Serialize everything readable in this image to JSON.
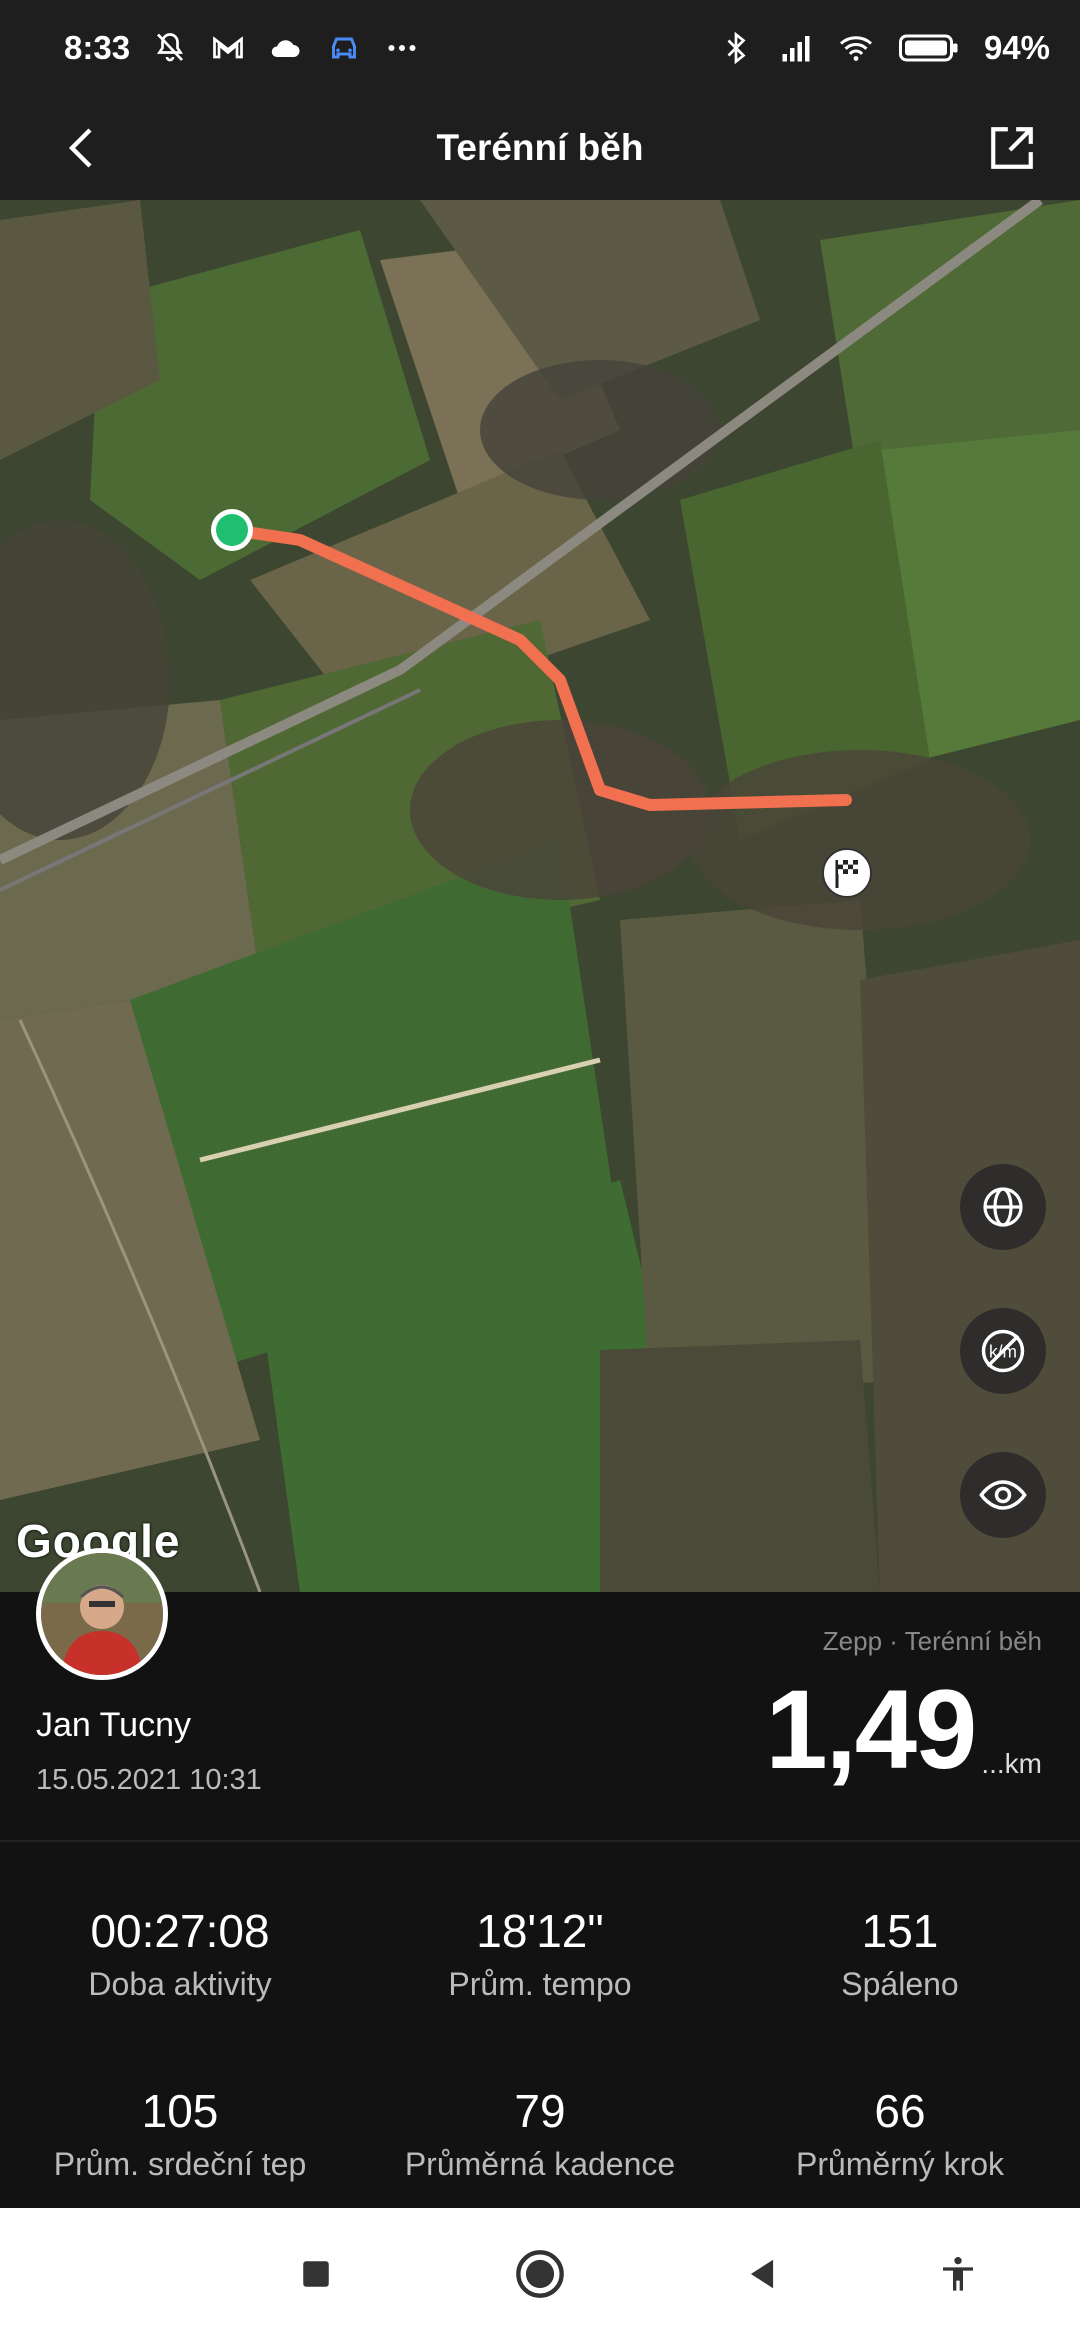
{
  "status_bar": {
    "time": "8:33",
    "battery": "94%",
    "icons_left": [
      "mute-icon",
      "gmail-icon",
      "cloud-icon",
      "car-icon",
      "more-dots-icon"
    ],
    "icons_right": [
      "bluetooth-icon",
      "signal-icon",
      "wifi-icon",
      "battery-icon"
    ]
  },
  "header": {
    "title": "Terénní běh",
    "back_icon": "back-arrow-icon",
    "share_icon": "share-icon"
  },
  "map": {
    "provider_logo": "Google",
    "route_color": "#f07050",
    "start_color": "#1fbf6f",
    "controls": [
      "globe-icon",
      "km-markers-off-icon",
      "eye-icon"
    ]
  },
  "activity": {
    "user_name": "Jan Tucny",
    "date": "15.05.2021 10:31",
    "source": "Zepp · Terénní běh",
    "distance": "1,49",
    "distance_unit": "...km"
  },
  "stats": [
    {
      "value": "00:27:08",
      "label": "Doba aktivity"
    },
    {
      "value": "18'12\"",
      "label": "Prům. tempo"
    },
    {
      "value": "151",
      "label": "Spáleno"
    },
    {
      "value": "105",
      "label": "Prům. srdeční tep"
    },
    {
      "value": "79",
      "label": "Průměrná kadence"
    },
    {
      "value": "66",
      "label": "Průměrný krok"
    }
  ],
  "nav": [
    "recents-icon",
    "home-icon",
    "back-icon",
    "accessibility-icon"
  ]
}
